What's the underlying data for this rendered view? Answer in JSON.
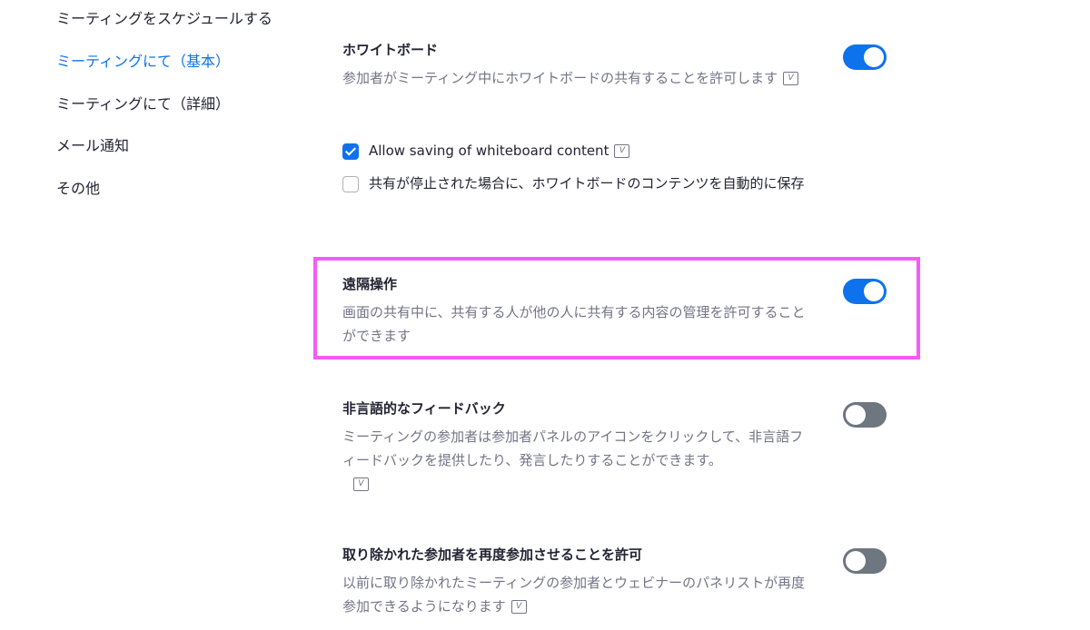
{
  "sidebar": {
    "items": [
      {
        "label": "ミーティングをスケジュールする",
        "active": false
      },
      {
        "label": "ミーティングにて（基本）",
        "active": true
      },
      {
        "label": "ミーティングにて（詳細）",
        "active": false
      },
      {
        "label": "メール通知",
        "active": false
      },
      {
        "label": "その他",
        "active": false
      }
    ]
  },
  "settings": {
    "whiteboard": {
      "title": "ホワイトボード",
      "description": "参加者がミーティング中にホワイトボードの共有することを許可します",
      "enabled": true,
      "options": [
        {
          "label": "Allow saving of whiteboard content",
          "checked": true
        },
        {
          "label": "共有が停止された場合に、ホワイトボードのコンテンツを自動的に保存",
          "checked": false
        }
      ]
    },
    "remote_control": {
      "title": "遠隔操作",
      "description": "画面の共有中に、共有する人が他の人に共有する内容の管理を許可することができます",
      "enabled": true
    },
    "nonverbal_feedback": {
      "title": "非言語的なフィードバック",
      "description": "ミーティングの参加者は参加者パネルのアイコンをクリックして、非言語フィードバックを提供したり、発言したりすることができます。",
      "enabled": false
    },
    "rejoin": {
      "title": "取り除かれた参加者を再度参加させることを許可",
      "description": "以前に取り除かれたミーティングの参加者とウェビナーのパネリストが再度参加できるようになります",
      "enabled": false
    }
  },
  "icons": {
    "version_badge": "V"
  },
  "colors": {
    "accent": "#0e72ed",
    "toggle_off": "#6e7680",
    "highlight": "#f45cf5",
    "muted_text": "#747487"
  }
}
